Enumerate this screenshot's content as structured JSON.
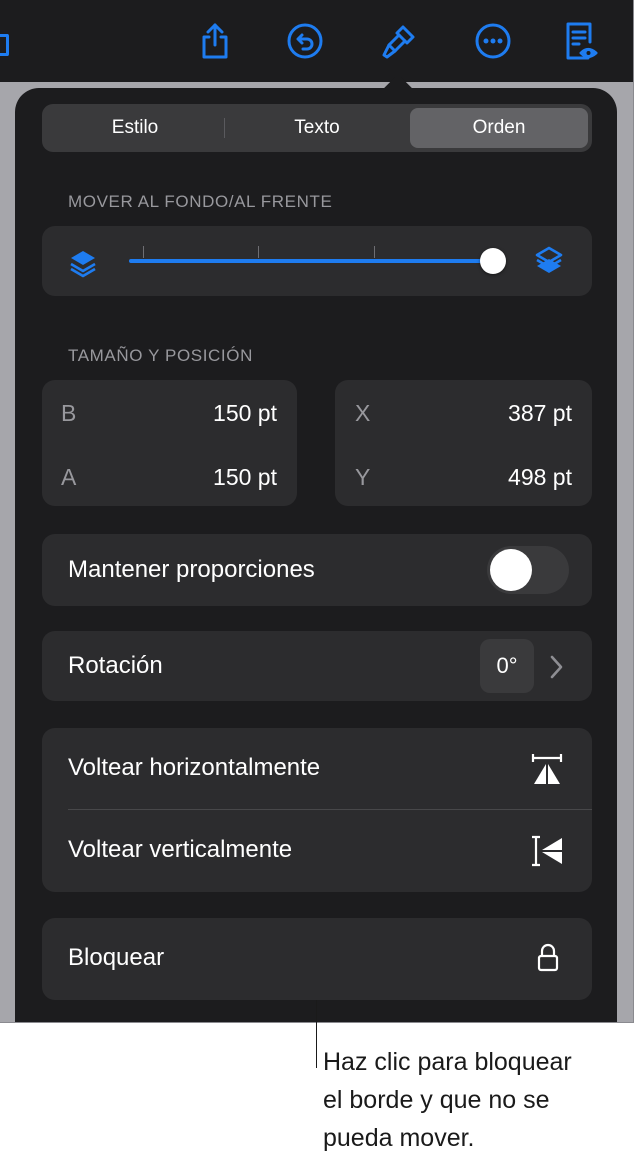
{
  "tabs": [
    {
      "label": "Estilo",
      "active": false
    },
    {
      "label": "Texto",
      "active": false
    },
    {
      "label": "Orden",
      "active": true
    }
  ],
  "arrange": {
    "section_label": "MOVER AL FONDO/AL FRENTE",
    "slider_value": 1.0
  },
  "size_position": {
    "section_label": "TAMAÑO Y POSICIÓN",
    "width_label": "B",
    "width_value": "150 pt",
    "height_label": "A",
    "height_value": "150 pt",
    "x_label": "X",
    "x_value": "387 pt",
    "y_label": "Y",
    "y_value": "498 pt"
  },
  "constrain": {
    "label": "Mantener proporciones",
    "on": false
  },
  "rotation": {
    "label": "Rotación",
    "value": "0°"
  },
  "flip": {
    "horizontal_label": "Voltear horizontalmente",
    "vertical_label": "Voltear verticalmente"
  },
  "lock": {
    "label": "Bloquear"
  },
  "callout": "Haz clic para bloquear\nel borde y que no se\npueda mover.",
  "colors": {
    "accent": "#1e7cf0",
    "panel": "#1c1c1e",
    "card": "#2c2c2e"
  },
  "toolbar_icons": [
    "share-icon",
    "undo-icon",
    "format-brush-icon",
    "more-icon",
    "reader-view-icon"
  ]
}
